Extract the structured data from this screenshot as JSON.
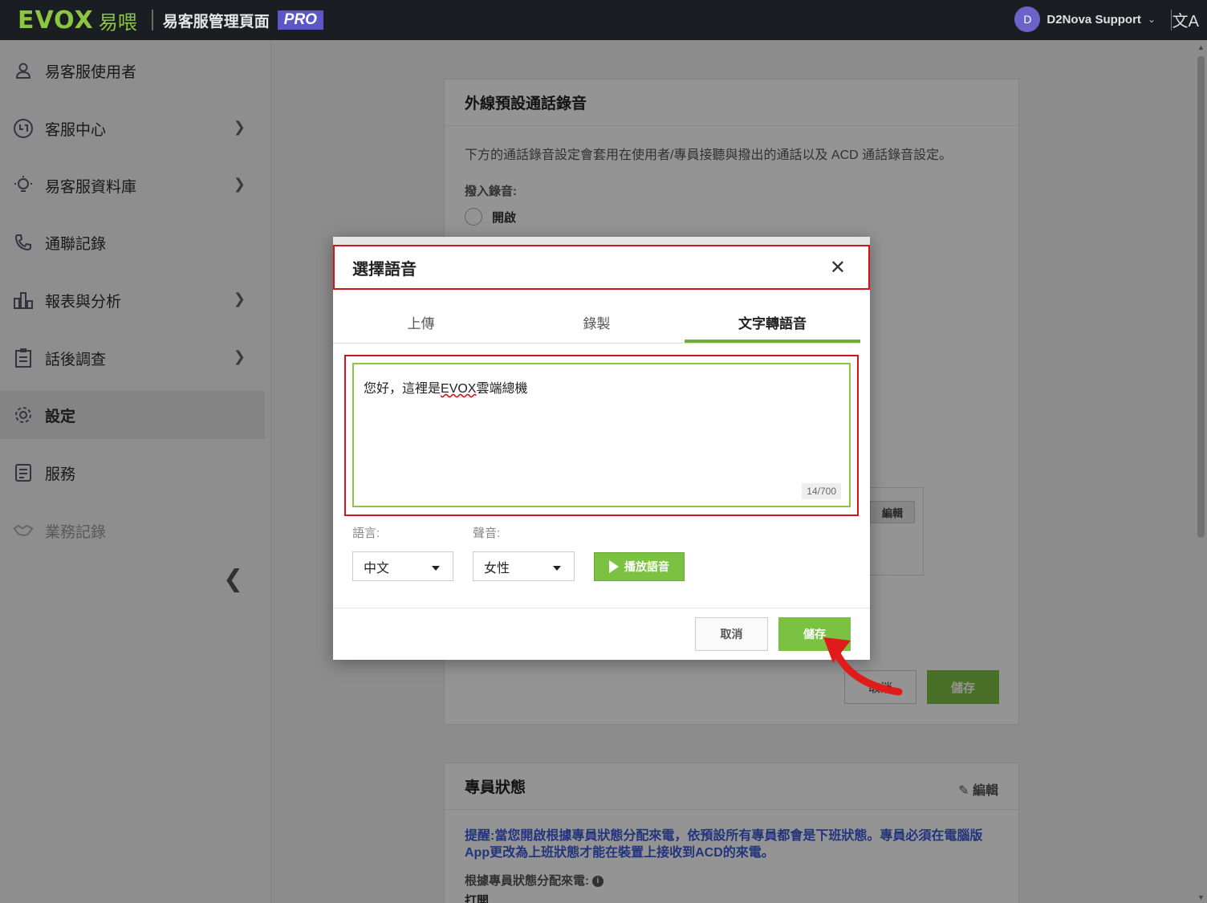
{
  "topbar": {
    "logo": "EVOX",
    "logo_cn": "易喂",
    "admin_title": "易客服管理頁面",
    "pro_badge": "PRO",
    "avatar_initial": "D",
    "user_name": "D2Nova Support"
  },
  "sidebar": {
    "items": [
      {
        "label": "易客服使用者",
        "icon": "user-icon",
        "has_children": false
      },
      {
        "label": "客服中心",
        "icon": "headset-icon",
        "has_children": true
      },
      {
        "label": "易客服資料庫",
        "icon": "lightbulb-icon",
        "has_children": true
      },
      {
        "label": "通聯記錄",
        "icon": "phone-icon",
        "has_children": false
      },
      {
        "label": "報表與分析",
        "icon": "bar-chart-icon",
        "has_children": true
      },
      {
        "label": "話後調查",
        "icon": "clipboard-icon",
        "has_children": true
      },
      {
        "label": "設定",
        "icon": "gear-icon",
        "has_children": false,
        "active": true
      },
      {
        "label": "服務",
        "icon": "list-icon",
        "has_children": false
      },
      {
        "label": "業務記錄",
        "icon": "handshake-icon",
        "has_children": false,
        "disabled": true
      }
    ]
  },
  "main": {
    "recording_card": {
      "title": "外線預設通話錄音",
      "description": "下方的通話錄音設定會套用在使用者/專員接聽與撥出的通話以及 ACD 通話錄音設定。",
      "dial_in_label": "撥入錄音:",
      "option_on": "開啟",
      "edit_label": "編輯",
      "cancel_label": "取消",
      "save_label": "儲存"
    },
    "agent_status_card": {
      "title": "專員狀態",
      "edit_label": "編輯",
      "warning": "提醒:當您開啟根據專員狀態分配來電，依預設所有專員都會是下班狀態。專員必須在電腦版App更改為上班狀態才能在裝置上接收到ACD的來電。",
      "assign_label": "根據專員狀態分配來電:",
      "assign_value": "打開"
    }
  },
  "modal": {
    "title": "選擇語音",
    "tabs": [
      "上傳",
      "錄製",
      "文字轉語音"
    ],
    "active_tab": 2,
    "tts_text_before": "您好，這裡是",
    "tts_text_flagged": "EVOX",
    "tts_text_after": "雲端總機",
    "char_count": "14/700",
    "language_label": "語言:",
    "language_value": "中文",
    "voice_label": "聲音:",
    "voice_value": "女性",
    "play_label": "播放語音",
    "cancel_label": "取消",
    "save_label": "儲存"
  },
  "colors": {
    "brand_green": "#8cc63f",
    "button_green": "#7cc242",
    "highlight_red": "#d2141b",
    "pro_purple": "#5b57c9",
    "topbar_bg": "#1a1d21"
  }
}
